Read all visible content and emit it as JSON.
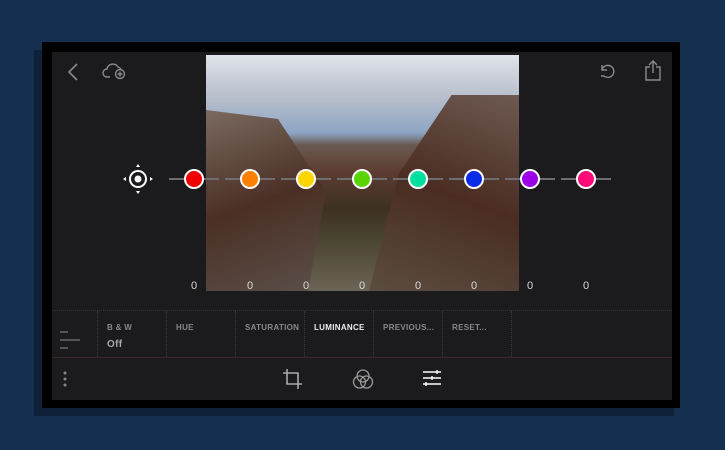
{
  "toolbar": {
    "back": "chevron-left-icon",
    "cloud": "cloud-add-icon",
    "undo": "undo-icon",
    "share": "share-icon"
  },
  "target_tool": "target-adjust-icon",
  "sliders": [
    {
      "name": "red",
      "color": "#f20000",
      "value": "0"
    },
    {
      "name": "orange",
      "color": "#ff7f00",
      "value": "0"
    },
    {
      "name": "yellow",
      "color": "#ffd500",
      "value": "0"
    },
    {
      "name": "green",
      "color": "#5ad400",
      "value": "0"
    },
    {
      "name": "aqua",
      "color": "#00dfa0",
      "value": "0"
    },
    {
      "name": "blue",
      "color": "#0a2be8",
      "value": "0"
    },
    {
      "name": "purple",
      "color": "#9a00e8",
      "value": "0"
    },
    {
      "name": "magenta",
      "color": "#ff0a78",
      "value": "0"
    }
  ],
  "tabs": [
    {
      "label": "B & W",
      "value": "Off"
    },
    {
      "label": "HUE"
    },
    {
      "label": "SATURATION"
    },
    {
      "label": "LUMINANCE",
      "active": true
    },
    {
      "label": "PREVIOUS..."
    },
    {
      "label": "RESET..."
    }
  ],
  "bottom": {
    "more": "more-vertical-icon",
    "crop": "crop-icon",
    "color": "color-mix-icon",
    "adjust": "sliders-icon"
  }
}
